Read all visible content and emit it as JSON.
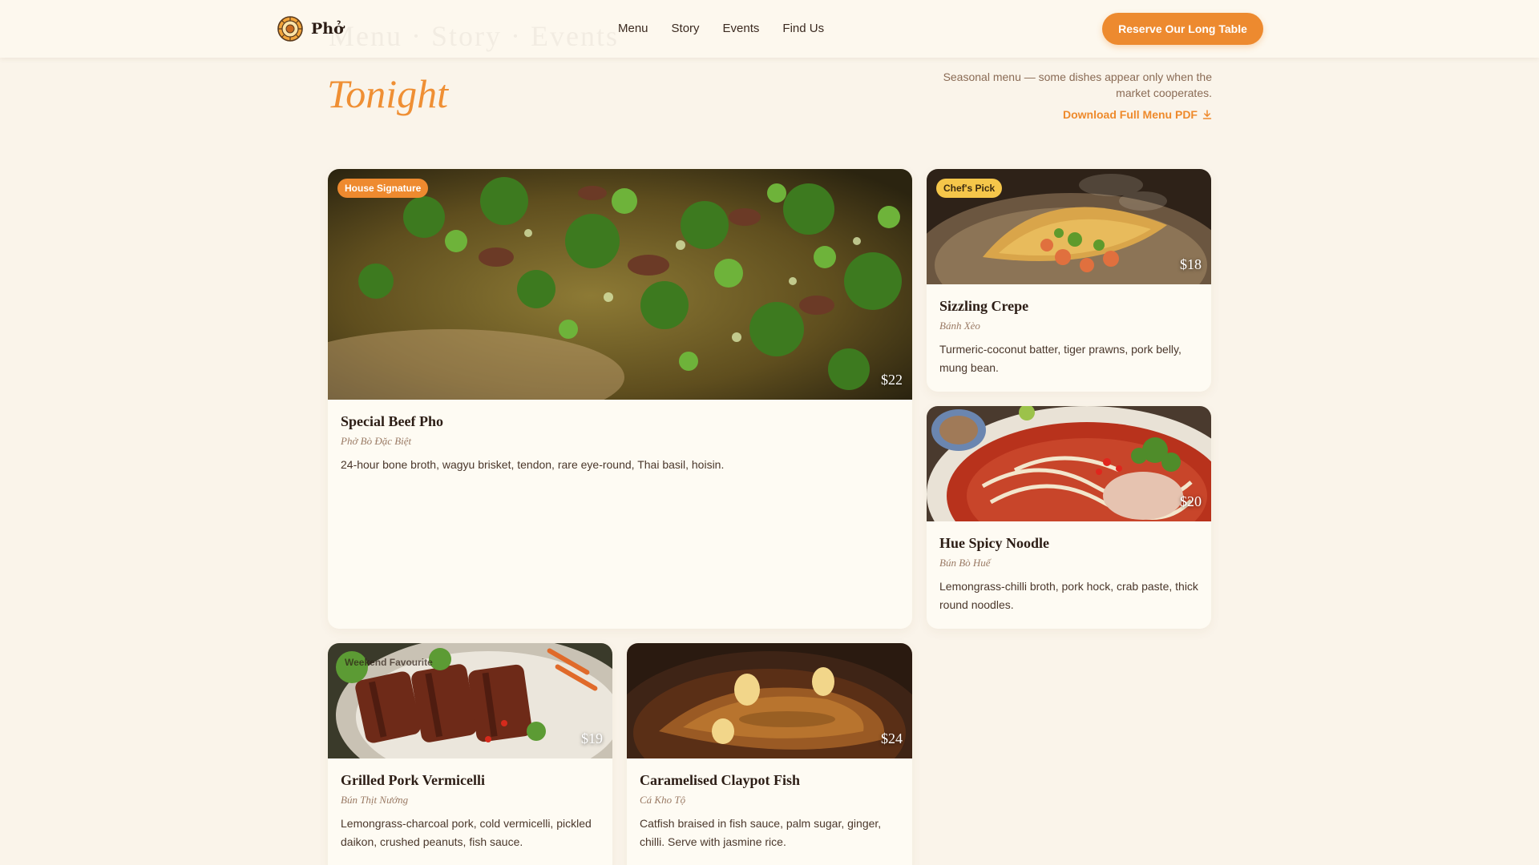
{
  "brand": {
    "name": "Phở",
    "accent": "#ED8A2F",
    "background": "#FAF4EA"
  },
  "ghost_heading": "Menu · Story · Events",
  "nav": [
    {
      "label": "Menu"
    },
    {
      "label": "Story"
    },
    {
      "label": "Events"
    },
    {
      "label": "Find Us"
    }
  ],
  "cta_label": "Reserve Our Long Table",
  "intro": {
    "title": "Tonight",
    "note": "Seasonal menu — some dishes appear only when the market cooperates.",
    "download_label": "Download Full Menu PDF",
    "download_icon": "download-icon"
  },
  "dishes": [
    {
      "badge": "House Signature",
      "price": "$22",
      "name": "Special Beef Pho",
      "native": "Phở Bò Đặc Biệt",
      "description": "24-hour bone broth, wagyu brisket, tendon, rare eye-round, Thai basil, hoisin."
    },
    {
      "badge": "Chef's Pick",
      "price": "$18",
      "name": "Sizzling Crepe",
      "native": "Bánh Xèo",
      "description": "Turmeric-coconut batter, tiger prawns, pork belly, mung bean."
    },
    {
      "price": "$20",
      "name": "Hue Spicy Noodle",
      "native": "Bún Bò Huế",
      "description": "Lemongrass-chilli broth, pork hock, crab paste, thick round noodles."
    },
    {
      "badge": "Weekend Favourite",
      "price": "$19",
      "name": "Grilled Pork Vermicelli",
      "native": "Bún Thịt Nướng",
      "description": "Lemongrass-charcoal pork, cold vermicelli, pickled daikon, crushed peanuts, fish sauce."
    },
    {
      "price": "$24",
      "name": "Caramelised Claypot Fish",
      "native": "Cá Kho Tộ",
      "description": "Catfish braised in fish sauce, palm sugar, ginger, chilli. Serve with jasmine rice."
    }
  ]
}
